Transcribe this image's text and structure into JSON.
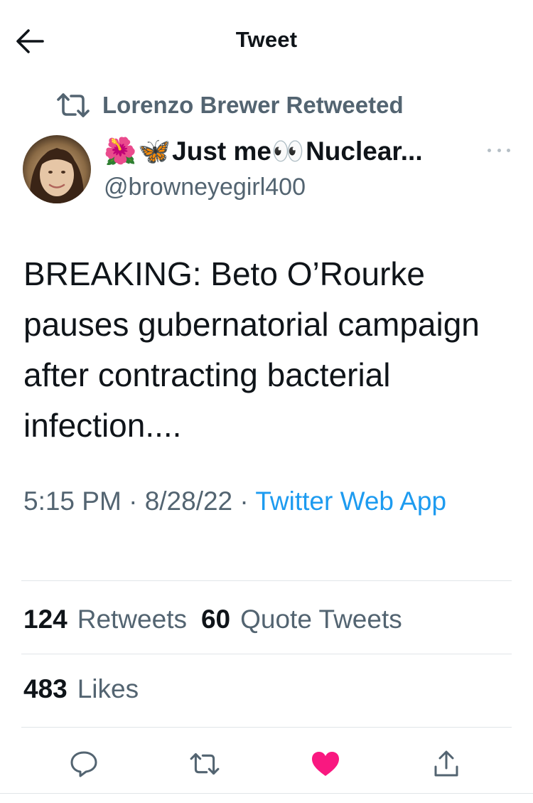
{
  "header": {
    "title": "Tweet",
    "back_icon": "arrow-left-icon"
  },
  "retweet_context": {
    "icon": "retweet-icon",
    "text": "Lorenzo Brewer Retweeted"
  },
  "author": {
    "display_name_emojis": [
      "🌺",
      "🦋"
    ],
    "display_name_part1": "Just me",
    "display_name_emoji_mid": "👀",
    "display_name_part2": "Nuclear...",
    "handle": "@browneyegirl400"
  },
  "tweet": {
    "text": "BREAKING: Beto O’Rourke pauses gubernatorial campaign after contracting bacterial infection...."
  },
  "meta": {
    "time": "5:15 PM",
    "separator": " · ",
    "date": "8/28/22",
    "source": "Twitter Web App"
  },
  "stats": {
    "retweets_count": "124",
    "retweets_label": "Retweets",
    "quotes_count": "60",
    "quotes_label": "Quote Tweets",
    "likes_count": "483",
    "likes_label": "Likes"
  },
  "actions": [
    {
      "icon": "reply-icon"
    },
    {
      "icon": "retweet-icon"
    },
    {
      "icon": "heart-filled-icon"
    },
    {
      "icon": "share-icon"
    }
  ],
  "colors": {
    "primary_text": "#0f1419",
    "secondary_text": "#536471",
    "link": "#1d9bf0",
    "like": "#f91880",
    "divider": "#e1e5e8"
  }
}
